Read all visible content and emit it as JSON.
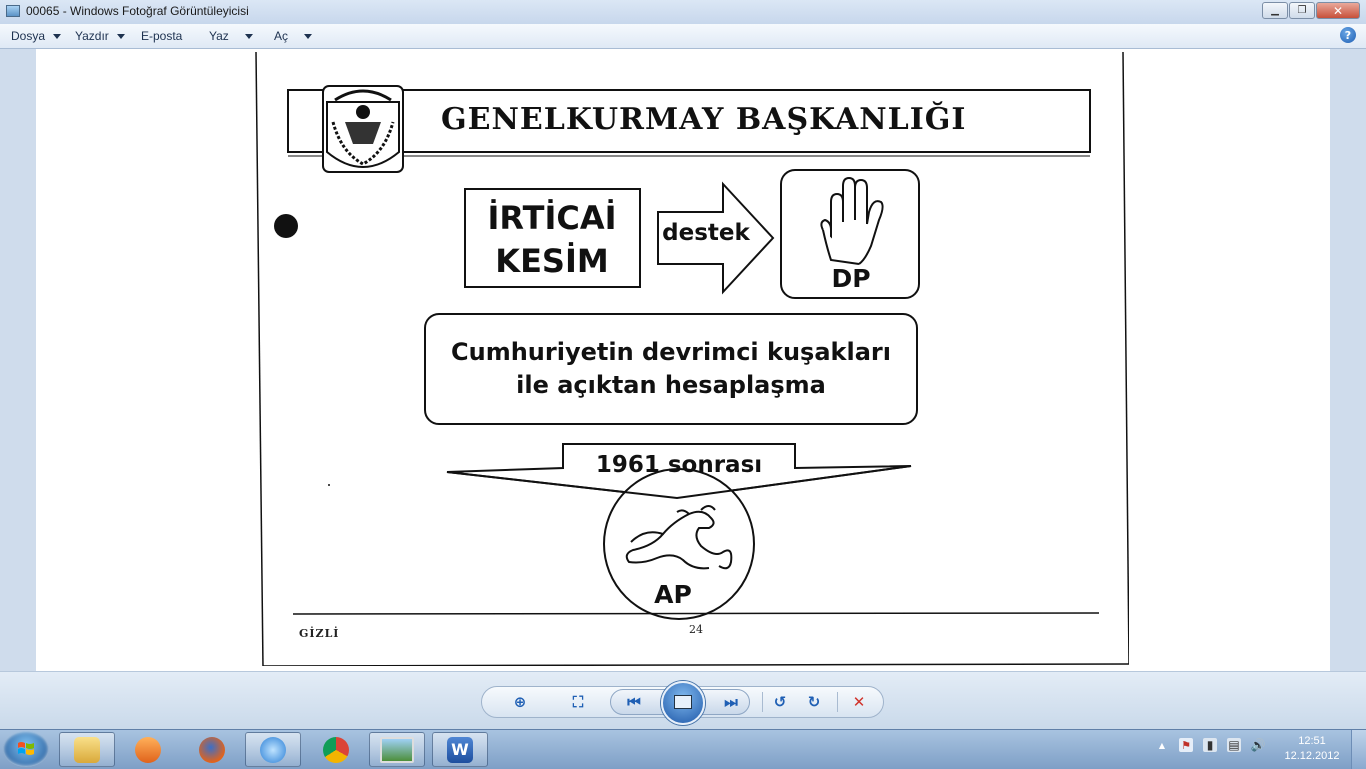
{
  "window": {
    "title": "00065 - Windows Fotoğraf Görüntüleyicisi",
    "minimize_glyph": "▁",
    "restore_glyph": "❐",
    "close_glyph": "✕"
  },
  "menu": {
    "items": [
      {
        "label": "Dosya",
        "has_caret": true
      },
      {
        "label": "Yazdır",
        "has_caret": true
      },
      {
        "label": "E-posta",
        "has_caret": false
      },
      {
        "label": "Yaz",
        "has_caret": true
      },
      {
        "label": "Aç",
        "has_caret": true
      }
    ],
    "help_glyph": "?"
  },
  "document": {
    "header_title": "GENELKURMAY   BAŞKANLIĞI",
    "box1_line1": "İRTİCAİ",
    "box1_line2": "KESİM",
    "arrow_label": "destek",
    "party1": "DP",
    "middle_line1": "Cumhuriyetin devrimci kuşakları",
    "middle_line2": "ile açıktan hesaplaşma",
    "after_label": "1961 sonrası",
    "party2": "AP",
    "classification": "GİZLİ",
    "page_number": "24"
  },
  "toolbar": {
    "zoom_glyph": "⊕",
    "fit_glyph": "⛶",
    "prev_glyph": "⏮",
    "next_glyph": "⏭",
    "rotate_ccw_glyph": "↺",
    "rotate_cw_glyph": "↻",
    "delete_glyph": "✕"
  },
  "taskbar": {
    "clock_time": "12:51",
    "clock_date": "12.12.2012",
    "tray_up_glyph": "▲",
    "tray_volume_glyph": "🔊"
  },
  "colors": {
    "accent": "#1f5fb4",
    "delete": "#d0342c"
  }
}
